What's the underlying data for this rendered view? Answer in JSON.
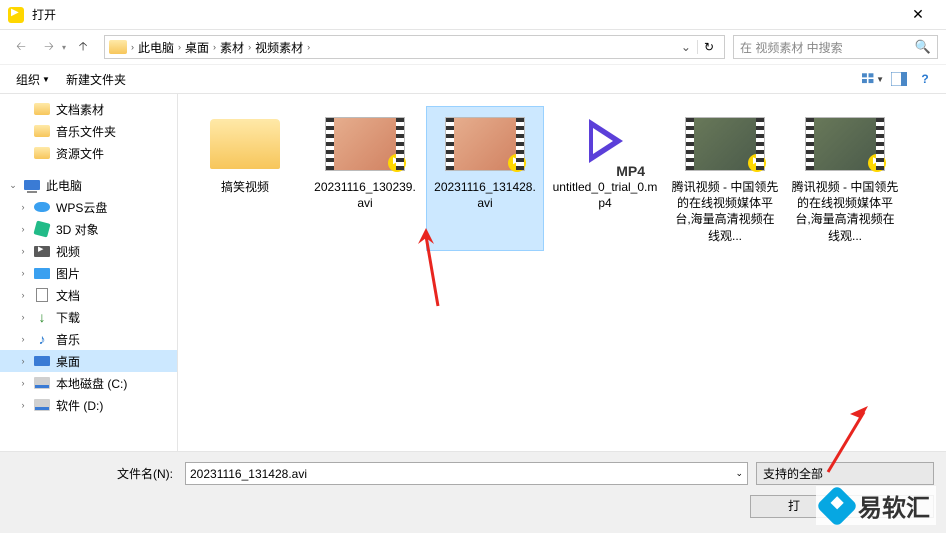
{
  "window": {
    "title": "打开"
  },
  "breadcrumb": {
    "items": [
      "此电脑",
      "桌面",
      "素材",
      "视频素材"
    ]
  },
  "search": {
    "placeholder": "在 视频素材 中搜索"
  },
  "toolbar": {
    "organize": "组织",
    "newfolder": "新建文件夹"
  },
  "tree": {
    "quick": [
      {
        "label": "文档素材"
      },
      {
        "label": "音乐文件夹"
      },
      {
        "label": "资源文件"
      }
    ],
    "pc_label": "此电脑",
    "pc": [
      {
        "label": "WPS云盘",
        "ico": "cloud"
      },
      {
        "label": "3D 对象",
        "ico": "3d"
      },
      {
        "label": "视频",
        "ico": "vid"
      },
      {
        "label": "图片",
        "ico": "pic"
      },
      {
        "label": "文档",
        "ico": "doc"
      },
      {
        "label": "下载",
        "ico": "dl"
      },
      {
        "label": "音乐",
        "ico": "music"
      },
      {
        "label": "桌面",
        "ico": "desk",
        "selected": true
      },
      {
        "label": "本地磁盘 (C:)",
        "ico": "disk"
      },
      {
        "label": "软件 (D:)",
        "ico": "disk"
      }
    ]
  },
  "files": [
    {
      "name": "搞笑视频",
      "type": "folder"
    },
    {
      "name": "20231116_130239.avi",
      "type": "video"
    },
    {
      "name": "20231116_131428.avi",
      "type": "video",
      "selected": true
    },
    {
      "name": "untitled_0_trial_0.mp4",
      "type": "mp4",
      "mp4label": "MP4"
    },
    {
      "name": "腾讯视频 - 中国领先的在线视频媒体平台,海量高清视频在线观...",
      "type": "tencent"
    },
    {
      "name": "腾讯视频 - 中国领先的在线视频媒体平台,海量高清视频在线观...",
      "type": "tencent"
    }
  ],
  "bottom": {
    "filename_label": "文件名(N):",
    "filename_value": "20231116_131428.avi",
    "filter_label": "支持的全部",
    "open": "打",
    "cancel": ""
  },
  "watermark": "易软汇"
}
